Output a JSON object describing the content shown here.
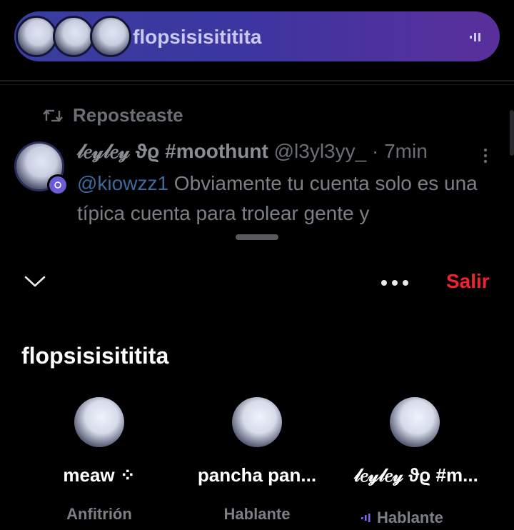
{
  "space_bar": {
    "title": "flopsisisititita",
    "host_avatars": [
      "avatar",
      "avatar",
      "avatar"
    ],
    "icon": "audio-wave-icon",
    "gradient_colors": [
      "#3a3ea0",
      "#5a2f9c"
    ]
  },
  "tweet": {
    "repost_label": "Reposteaste",
    "repost_icon": "retweet-icon",
    "display_name": "𝓁𝑒𝓎𝓁𝑒𝓎 ϑϱ #moothunt",
    "handle": "@l3yl3yy_",
    "time": "· 7min",
    "mention": "@kiowzz1",
    "text": " Obviamente tu cuenta solo es una típica cuenta para trolear gente y",
    "more_icon": "more-vertical-icon"
  },
  "sheet": {
    "collapse_icon": "chevron-down-icon",
    "more_icon": "more-horizontal-icon",
    "leave_label": "Salir",
    "leave_color": "#f4212e",
    "space_title": "flopsisisititita"
  },
  "participants": [
    {
      "name": "meaw ⁘",
      "role": "Anfitrión"
    },
    {
      "name": "pancha pan...",
      "role": "Hablante"
    },
    {
      "name": "𝓁𝑒𝓎𝓁𝑒𝓎 ϑϱ #m...",
      "role": "Hablante",
      "speaking": true
    }
  ]
}
